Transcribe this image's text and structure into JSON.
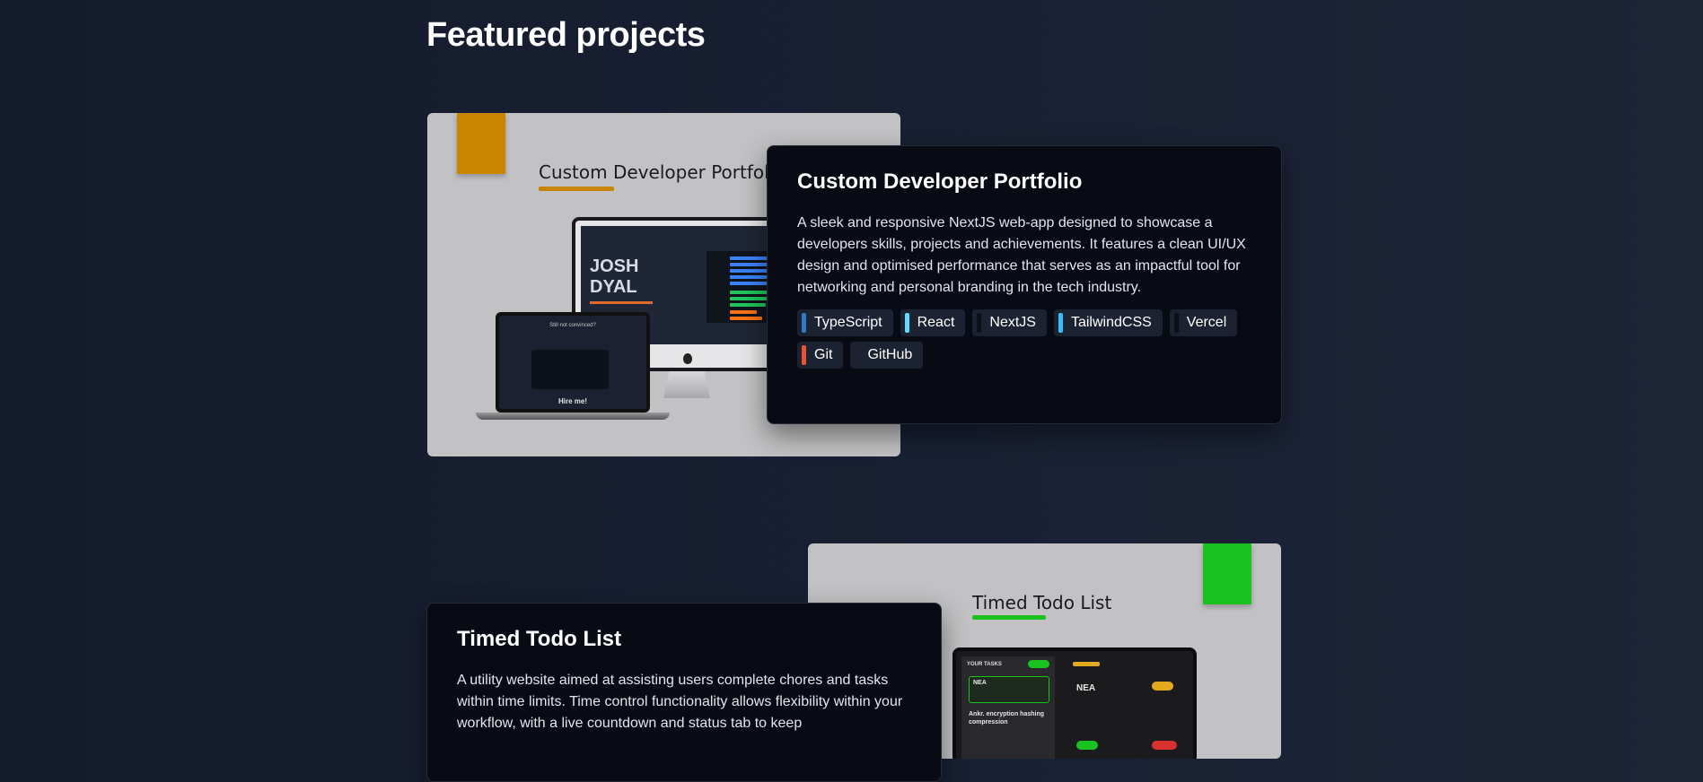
{
  "section_title": "Featured projects",
  "projects": [
    {
      "title": "Custom Developer Portfolio",
      "image_title": "Custom Developer Portfolio",
      "accent_color": "#c98400",
      "mockup": {
        "hero_name": "JOSH DYAL",
        "laptop_headline": "Still not convinced?",
        "laptop_cta": "Hire me!"
      },
      "description": "A sleek and responsive NextJS web-app designed to showcase a developers skills, projects and achievements. It features a clean UI/UX design and optimised performance that serves as an impactful tool for networking and personal branding in the tech industry.",
      "tags": [
        {
          "label": "TypeScript",
          "color": "#3178c6"
        },
        {
          "label": "React",
          "color": "#61dafb"
        },
        {
          "label": "NextJS",
          "color": "#0b0f18"
        },
        {
          "label": "TailwindCSS",
          "color": "#38bdf8"
        },
        {
          "label": "Vercel",
          "color": "#0b0f18"
        },
        {
          "label": "Git",
          "color": "#f05032"
        },
        {
          "label": "GitHub",
          "color": "#1b2231"
        }
      ]
    },
    {
      "title": "Timed Todo List",
      "image_title": "Timed Todo List",
      "accent_color": "#19c21e",
      "mockup": {
        "tasks_header": "YOUR TASKS",
        "task_1": "NEA",
        "task_2": "Ankr. encryption hashing compression",
        "detail_title": "NEA"
      },
      "description": "A utility website aimed at assisting users complete chores and tasks within time limits. Time control functionality allows flexibility within your workflow, with a live countdown and status tab to keep",
      "tags": []
    }
  ]
}
